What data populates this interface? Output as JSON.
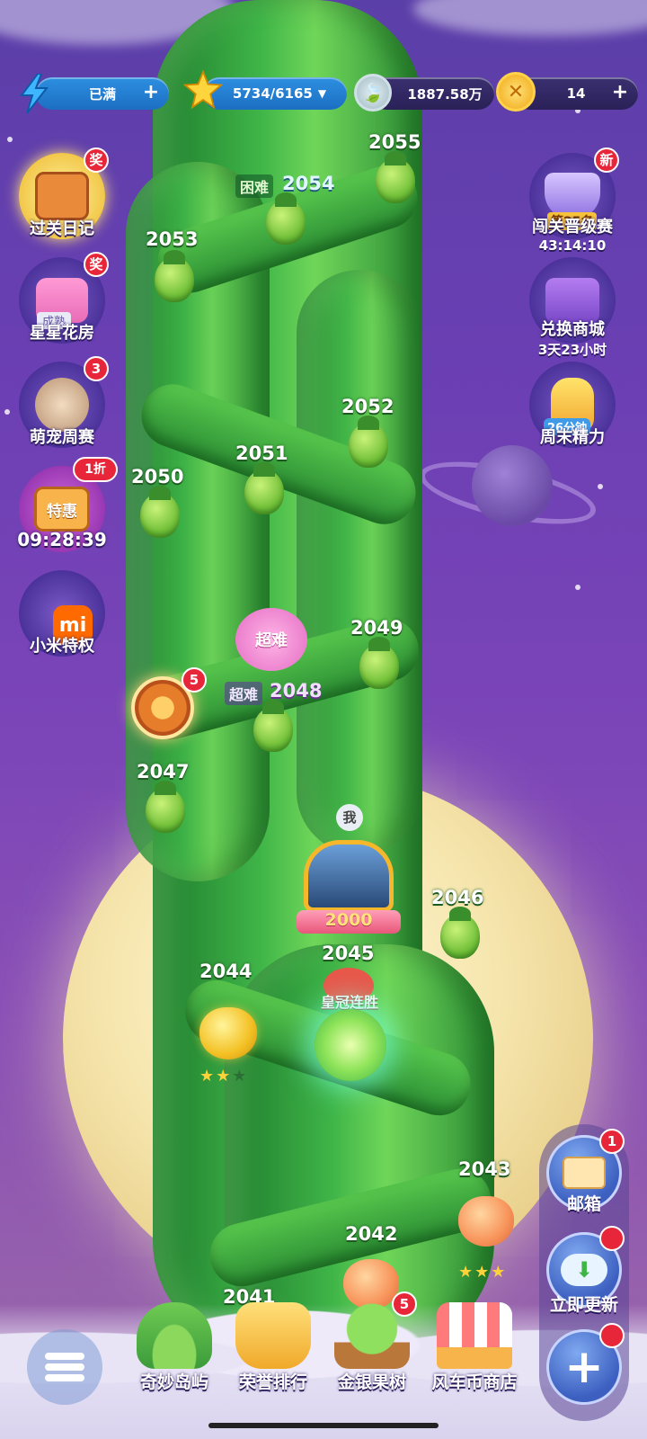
{
  "top_bar": {
    "energy": {
      "value": "已满",
      "icon": "lightning-icon"
    },
    "stars": {
      "value": "5734/6165",
      "icon": "star-icon"
    },
    "coins_silver": {
      "value": "1887.58万",
      "icon": "silver-coin-icon"
    },
    "coins_gold": {
      "value": "14",
      "icon": "gold-coin-icon"
    }
  },
  "left_menu": [
    {
      "label": "过关日记",
      "badge": "奖",
      "icon": "diary-icon"
    },
    {
      "label": "星星花房",
      "badge": "奖",
      "icon_text": "成熟",
      "icon": "flower-house-icon"
    },
    {
      "label": "萌宠周赛",
      "badge": "3",
      "icon": "pet-cat-icon"
    },
    {
      "label": "09:28:39",
      "badge": "1折",
      "icon_text": "特惠",
      "icon": "sale-shop-icon"
    },
    {
      "label": "小米特权",
      "icon_text": "mi",
      "icon": "xiaomi-icon"
    }
  ],
  "right_menu": [
    {
      "label": "闯关晋级赛",
      "sub": "43:14:10",
      "badge": "新",
      "icon_text": "第25名",
      "icon": "trophy-icon"
    },
    {
      "label": "兑换商城",
      "sub": "3天23小时",
      "icon": "exchange-shop-icon"
    },
    {
      "label": "周末精力",
      "icon_text": "26分钟",
      "icon": "potion-icon"
    }
  ],
  "levels": {
    "l2055": "2055",
    "l2054": "2054",
    "l2054_tag": "困难",
    "l2053": "2053",
    "l2052": "2052",
    "l2051": "2051",
    "l2050": "2050",
    "l2049": "2049",
    "l2048": "2048",
    "l2048_tag": "超难",
    "flower_tag": "超难",
    "l2047": "2047",
    "l2046": "2046",
    "l2045": "2045",
    "l2045_tag": "皇冠连胜",
    "l2044": "2044",
    "l2043": "2043",
    "l2042": "2042",
    "l2041": "2041",
    "wheel_badge": "5",
    "me_marker": "我",
    "avatar_level": "2000"
  },
  "stars_2044": {
    "earned": 2,
    "total": 3
  },
  "stars_2043": {
    "earned": 3,
    "total": 3
  },
  "right_panel": {
    "mail": {
      "label": "邮箱",
      "badge": "1",
      "icon": "mail-icon"
    },
    "update": {
      "label": "立即更新",
      "icon": "cloud-download-icon"
    },
    "plus_icon": "plus-icon"
  },
  "bottom_nav": [
    {
      "label": "奇妙岛屿",
      "icon": "island-icon"
    },
    {
      "label": "荣誉排行",
      "icon": "crown-icon"
    },
    {
      "label": "金银果树",
      "badge": "5",
      "icon": "fruit-tree-icon"
    },
    {
      "label": "风车币商店",
      "icon": "shop-icon"
    }
  ],
  "menu_icon": "menu-list-icon",
  "colors": {
    "background": "#6a3fb3",
    "vine": "#3fb548",
    "badge": "#e8263a",
    "moon": "#f6e6ae"
  }
}
